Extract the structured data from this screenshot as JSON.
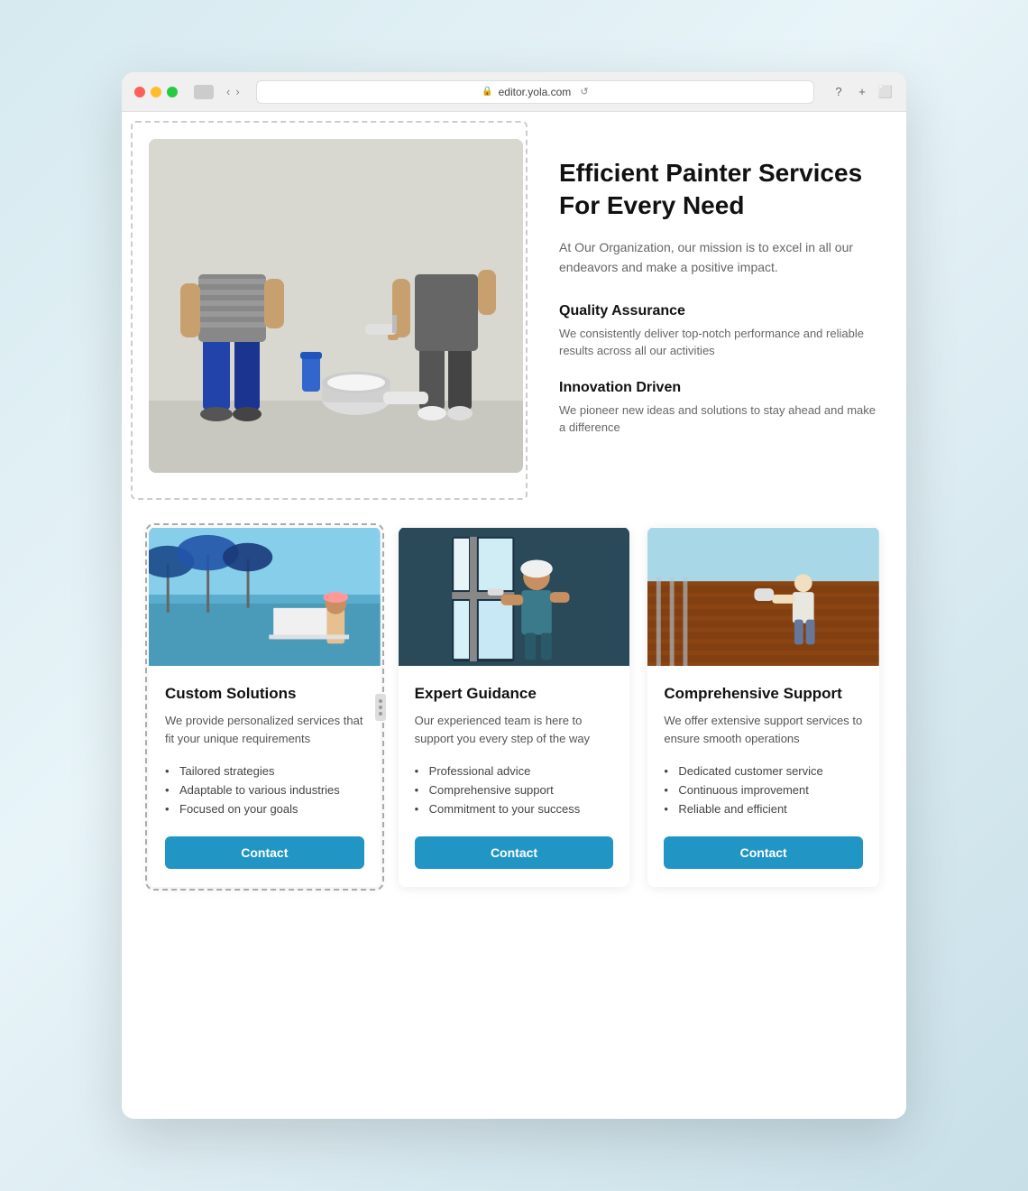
{
  "browser": {
    "url": "editor.yola.com",
    "tab_icon": "page-icon"
  },
  "hero": {
    "title": "Efficient Painter Services For Every Need",
    "subtitle": "At Our Organization, our mission is to excel in all our endeavors and make a positive impact.",
    "features": [
      {
        "title": "Quality Assurance",
        "desc": "We consistently deliver top-notch performance and reliable results across all our activities"
      },
      {
        "title": "Innovation Driven",
        "desc": "We pioneer new ideas and solutions to stay ahead and make a difference"
      }
    ]
  },
  "cards": [
    {
      "title": "Custom Solutions",
      "desc": "We provide personalized services that fit your unique requirements",
      "list": [
        "Tailored strategies",
        "Adaptable to various industries",
        "Focused on your goals"
      ],
      "button": "Contact"
    },
    {
      "title": "Expert Guidance",
      "desc": "Our experienced team is here to support you every step of the way",
      "list": [
        "Professional advice",
        "Comprehensive support",
        "Commitment to your success"
      ],
      "button": "Contact"
    },
    {
      "title": "Comprehensive Support",
      "desc": "We offer extensive support services to ensure smooth operations",
      "list": [
        "Dedicated customer service",
        "Continuous improvement",
        "Reliable and efficient"
      ],
      "button": "Contact"
    }
  ],
  "nav": {
    "back": "‹",
    "forward": "›"
  }
}
